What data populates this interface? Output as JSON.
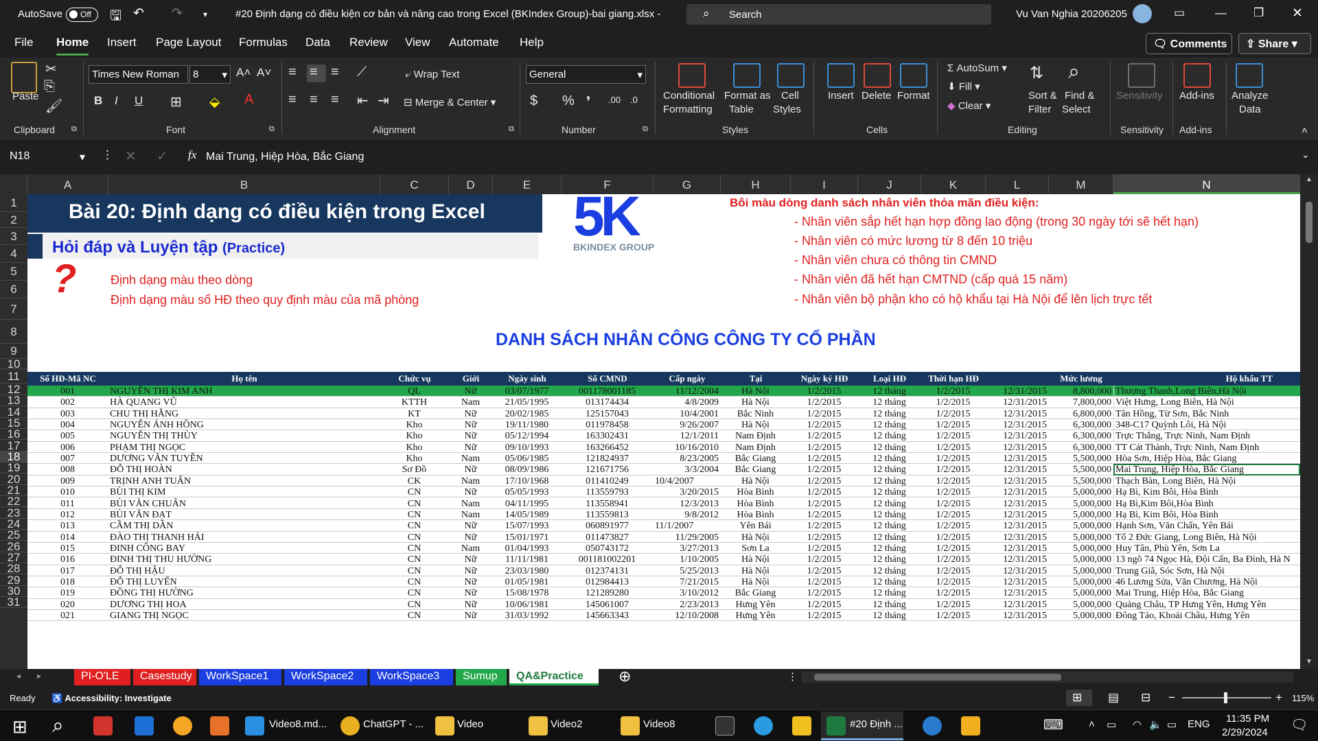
{
  "titlebar": {
    "autosave": "AutoSave",
    "toggle": "Off",
    "filename": "#20 Định dạng có điều kiện cơ bản và nâng cao trong Excel (BKIndex Group)-bai giang.xlsx  -",
    "search": "Search",
    "user": "Vu Van Nghia 20206205"
  },
  "menu": {
    "items": [
      "File",
      "Home",
      "Insert",
      "Page Layout",
      "Formulas",
      "Data",
      "Review",
      "View",
      "Automate",
      "Help"
    ],
    "active": "Home",
    "comments": "Comments",
    "share": "Share"
  },
  "ribbon": {
    "clipboard": {
      "paste": "Paste",
      "label": "Clipboard"
    },
    "font": {
      "name": "Times New Roman",
      "size": "8",
      "label": "Font",
      "bold": "B",
      "italic": "I",
      "underline": "U"
    },
    "alignment": {
      "wrap": "Wrap Text",
      "merge": "Merge & Center",
      "label": "Alignment"
    },
    "number": {
      "format": "General",
      "label": "Number"
    },
    "styles": {
      "cond": [
        "Conditional",
        "Formatting"
      ],
      "table": [
        "Format as",
        "Table"
      ],
      "cell": [
        "Cell",
        "Styles"
      ],
      "label": "Styles"
    },
    "cells": {
      "insert": "Insert",
      "delete": "Delete",
      "format": "Format",
      "label": "Cells"
    },
    "editing": {
      "autosum": "AutoSum",
      "fill": "Fill",
      "clear": "Clear",
      "sort": [
        "Sort &",
        "Filter"
      ],
      "find": [
        "Find &",
        "Select"
      ],
      "label": "Editing"
    },
    "sensitivity": {
      "btn": "Sensitivity",
      "label": "Sensitivity"
    },
    "addins": {
      "btn": "Add-ins",
      "label": "Add-ins"
    },
    "analyze": {
      "btn": [
        "Analyze",
        "Data"
      ]
    }
  },
  "formula": {
    "namebox": "N18",
    "content": "Mai Trung, Hiệp Hòa, Bắc Giang"
  },
  "columns": [
    "A",
    "B",
    "C",
    "D",
    "E",
    "F",
    "G",
    "H",
    "I",
    "J",
    "K",
    "L",
    "M",
    "N"
  ],
  "rows": [
    "1",
    "2",
    "3",
    "4",
    "5",
    "6",
    "7",
    "8",
    "9",
    "10",
    "11",
    "12",
    "13",
    "14",
    "15",
    "16",
    "17",
    "18",
    "19",
    "20",
    "21",
    "22",
    "23",
    "24",
    "25",
    "26",
    "27",
    "28",
    "29",
    "30",
    "31"
  ],
  "sheet": {
    "title": "Bài 20:  Định dạng có điều kiện trong Excel",
    "subtitle": "Hỏi đáp và Luyện tập",
    "subtitle_tag": "(Practice)",
    "qmark": "?",
    "questions": [
      "Định dạng màu theo dòng",
      "Định dạng màu số HĐ theo quy định màu của mã phòng"
    ],
    "logo_text": "BKINDEX GROUP",
    "conditions_title": "Bôi màu dòng danh sách nhân viên thỏa mãn điều kiện:",
    "conditions": [
      "- Nhân viên sắp hết hạn hợp đồng lao động (trong 30 ngày tới sẽ hết hạn)",
      "- Nhân viên có mức lương từ 8 đến 10 triệu",
      "- Nhân viên chưa có thông tin CMND",
      "- Nhân viên đã hết hạn CMTND (cấp quá 15 năm)",
      "- Nhân viên bộ phận kho có hộ khẩu tại Hà Nội để lên lịch trực tết"
    ],
    "list_title": "DANH SÁCH NHÂN CÔNG CÔNG TY CỔ PHẦN",
    "headers": [
      "Số HĐ-Mã NC",
      "Họ tên",
      "Chức vụ",
      "Giới",
      "Ngày sinh",
      "Số CMND",
      "Cấp ngày",
      "Tại",
      "Ngày ký HĐ",
      "Loại HĐ",
      "Thời hạn HĐ",
      "",
      "Mức lương",
      "Hộ khẩu TT"
    ],
    "data": [
      [
        "001",
        "NGUYỄN THỊ KIM ANH",
        "QL",
        "Nữ",
        "03/07/1977",
        "001178001185",
        "11/12/2004",
        "Hà Nội",
        "1/2/2015",
        "12 tháng",
        "1/2/2015",
        "12/31/2015",
        "8,800,000",
        "Thượng Thanh,Long Biên,Hà Nội"
      ],
      [
        "002",
        "HÀ QUANG VŨ",
        "KTTH",
        "Nam",
        "21/05/1995",
        "013174434",
        "4/8/2009",
        "Hà Nội",
        "1/2/2015",
        "12 tháng",
        "1/2/2015",
        "12/31/2015",
        "7,800,000",
        "Việt Hưng, Long Biên, Hà Nội"
      ],
      [
        "003",
        "CHU THỊ HẰNG",
        "KT",
        "Nữ",
        "20/02/1985",
        "125157043",
        "10/4/2001",
        "Bắc Ninh",
        "1/2/2015",
        "12 tháng",
        "1/2/2015",
        "12/31/2015",
        "6,800,000",
        "Tân Hồng, Từ Sơn, Bắc Ninh"
      ],
      [
        "004",
        "NGUYỄN ÁNH HỒNG",
        "Kho",
        "Nữ",
        "19/11/1980",
        "011978458",
        "9/26/2007",
        "Hà Nội",
        "1/2/2015",
        "12 tháng",
        "1/2/2015",
        "12/31/2015",
        "6,300,000",
        "348-C17 Quỳnh Lôi, Hà Nội"
      ],
      [
        "005",
        "NGUYỄN THỊ THÙY",
        "Kho",
        "Nữ",
        "05/12/1994",
        "163302431",
        "12/1/2011",
        "Nam Định",
        "1/2/2015",
        "12 tháng",
        "1/2/2015",
        "12/31/2015",
        "6,300,000",
        "Trực Thắng, Trực Ninh, Nam Định"
      ],
      [
        "006",
        "PHẠM THỊ NGỌC",
        "Kho",
        "Nữ",
        "09/10/1993",
        "163266452",
        "10/16/2010",
        "Nam Định",
        "1/2/2015",
        "12 tháng",
        "1/2/2015",
        "12/31/2015",
        "6,300,000",
        "TT Cát Thành, Trực Ninh, Nam Định"
      ],
      [
        "007",
        "DƯƠNG VĂN TUYỀN",
        "Kho",
        "Nam",
        "05/06/1985",
        "121824937",
        "8/23/2005",
        "Bắc Giang",
        "1/2/2015",
        "12 tháng",
        "1/2/2015",
        "12/31/2015",
        "5,500,000",
        "Hòa Sơn, Hiệp Hòa, Bắc Giang"
      ],
      [
        "008",
        "ĐỖ THỊ HOÀN",
        "Sơ Đồ",
        "Nữ",
        "08/09/1986",
        "121671756",
        "3/3/2004",
        "Bắc Giang",
        "1/2/2015",
        "12 tháng",
        "1/2/2015",
        "12/31/2015",
        "5,500,000",
        "Mai Trung, Hiệp Hòa, Bắc Giang"
      ],
      [
        "009",
        "TRỊNH ANH TUẤN",
        "CK",
        "Nam",
        "17/10/1968",
        "011410249",
        "10/4/2007",
        "Hà Nội",
        "1/2/2015",
        "12 tháng",
        "1/2/2015",
        "12/31/2015",
        "5,500,000",
        "Thạch Bàn, Long Biên, Hà Nội"
      ],
      [
        "010",
        "BÙI THỊ KIM",
        "CN",
        "Nữ",
        "05/05/1993",
        "113559793",
        "3/20/2015",
        "Hòa Bình",
        "1/2/2015",
        "12 tháng",
        "1/2/2015",
        "12/31/2015",
        "5,000,000",
        "Hạ Bì, Kim Bôi, Hòa Bình"
      ],
      [
        "011",
        "BÙI VĂN CHUÂN",
        "CN",
        "Nam",
        "04/11/1995",
        "113558941",
        "12/3/2013",
        "Hòa Bình",
        "1/2/2015",
        "12 tháng",
        "1/2/2015",
        "12/31/2015",
        "5,000,000",
        "Hạ Bì,Kim Bôi,Hòa Bình"
      ],
      [
        "012",
        "BÙI VĂN ĐẠT",
        "CN",
        "Nam",
        "14/05/1989",
        "113559813",
        "9/8/2012",
        "Hòa Bình",
        "1/2/2015",
        "12 tháng",
        "1/2/2015",
        "12/31/2015",
        "5,000,000",
        "Hạ Bì, Kim Bôi, Hòa Bình"
      ],
      [
        "013",
        "CẦM THỊ DẦN",
        "CN",
        "Nữ",
        "15/07/1993",
        "060891977",
        "11/1/2007",
        "Yên Bái",
        "1/2/2015",
        "12 tháng",
        "1/2/2015",
        "12/31/2015",
        "5,000,000",
        "Hạnh Sơn, Văn Chấn, Yên Bái"
      ],
      [
        "014",
        "ĐÀO THỊ THANH HẢI",
        "CN",
        "Nữ",
        "15/01/1971",
        "011473827",
        "11/29/2005",
        "Hà Nội",
        "1/2/2015",
        "12 tháng",
        "1/2/2015",
        "12/31/2015",
        "5,000,000",
        "Tổ 2 Đức Giang, Long Biên, Hà Nội"
      ],
      [
        "015",
        "ĐINH CÔNG BAY",
        "CN",
        "Nam",
        "01/04/1993",
        "050743172",
        "3/27/2013",
        "Sơn La",
        "1/2/2015",
        "12 tháng",
        "1/2/2015",
        "12/31/2015",
        "5,000,000",
        "Huy Tân, Phù Yên, Sơn La"
      ],
      [
        "016",
        "ĐINH THỊ THU HƯỜNG",
        "CN",
        "Nữ",
        "11/11/1981",
        "001181002201",
        "1/10/2005",
        "Hà Nội",
        "1/2/2015",
        "12 tháng",
        "1/2/2015",
        "12/31/2015",
        "5,000,000",
        "13 ngõ 74 Ngọc Hà, Đội Cấn, Ba Đình, Hà N"
      ],
      [
        "017",
        "ĐỖ THỊ HẬU",
        "CN",
        "Nữ",
        "23/03/1980",
        "012374131",
        "5/25/2013",
        "Hà Nội",
        "1/2/2015",
        "12 tháng",
        "1/2/2015",
        "12/31/2015",
        "5,000,000",
        "Trung Giã, Sóc Sơn, Hà Nội"
      ],
      [
        "018",
        "ĐỖ THỊ LUYẾN",
        "CN",
        "Nữ",
        "01/05/1981",
        "012984413",
        "7/21/2015",
        "Hà Nội",
        "1/2/2015",
        "12 tháng",
        "1/2/2015",
        "12/31/2015",
        "5,000,000",
        "46 Lương Sửa, Văn Chương, Hà Nội"
      ],
      [
        "019",
        "ĐỒNG THỊ HƯỜNG",
        "CN",
        "Nữ",
        "15/08/1978",
        "121289280",
        "3/10/2012",
        "Bắc Giang",
        "1/2/2015",
        "12 tháng",
        "1/2/2015",
        "12/31/2015",
        "5,000,000",
        "Mai Trung, Hiệp Hòa, Bắc Giang"
      ],
      [
        "020",
        "DƯƠNG THỊ HOA",
        "CN",
        "Nữ",
        "10/06/1981",
        "145061007",
        "2/23/2013",
        "Hưng Yên",
        "1/2/2015",
        "12 tháng",
        "1/2/2015",
        "12/31/2015",
        "5,000,000",
        "Quảng Châu, TP Hưng Yên, Hưng Yên"
      ],
      [
        "021",
        "GIANG THỊ NGỌC",
        "CN",
        "Nữ",
        "31/03/1992",
        "145663343",
        "12/10/2008",
        "Hưng Yên",
        "1/2/2015",
        "12 tháng",
        "1/2/2015",
        "12/31/2015",
        "5,000,000",
        "Đông Tảo, Khoái Châu, Hưng Yên"
      ]
    ]
  },
  "tabs": [
    {
      "label": "PI-O'LE",
      "color": "#e02020"
    },
    {
      "label": "Casestudy",
      "color": "#e02020"
    },
    {
      "label": "WorkSpace1",
      "color": "#1a3ee0"
    },
    {
      "label": "WorkSpace2",
      "color": "#1a3ee0"
    },
    {
      "label": "WorkSpace3",
      "color": "#1a3ee0"
    },
    {
      "label": "Sumup",
      "color": "#22a84a"
    },
    {
      "label": "QA&Practice",
      "color": "#ffffff"
    }
  ],
  "status": {
    "ready": "Ready",
    "accessibility": "Accessibility: Investigate",
    "zoom": "115%"
  },
  "taskbar": {
    "items": [
      "Video8.md...",
      "ChatGPT - ...",
      "Video",
      "Video2",
      "Video8",
      "#20 Định ..."
    ],
    "lang": "ENG",
    "time": "11:35 PM",
    "date": "2/29/2024"
  }
}
